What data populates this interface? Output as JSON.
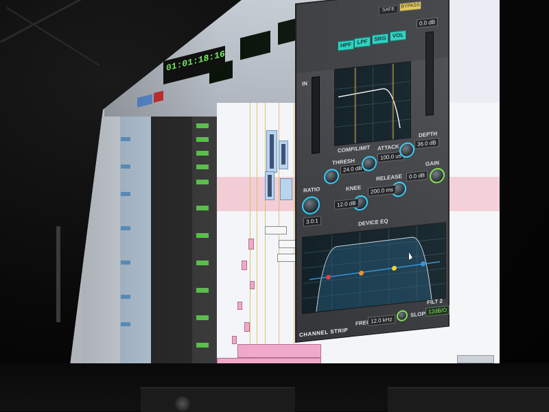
{
  "transport": {
    "counter": "01:01:18:16"
  },
  "plugin": {
    "title": "CHANNEL STRIP",
    "header": {
      "bypass": "BYPASS",
      "safe": "SAFE",
      "filter_buttons": [
        "HPF",
        "LPF",
        "SRG",
        "VOL"
      ]
    },
    "meters": {
      "in_label": "IN",
      "vol_value": "0.0 dB"
    },
    "comp": {
      "section": "COMP/LIMIT",
      "thresh_label": "THRESH",
      "thresh_value": "24.0 dB",
      "attack_label": "ATTACK",
      "attack_value": "100.0 us",
      "depth_label": "DEPTH",
      "depth_value": "36.0 dB",
      "ratio_label": "RATIO",
      "ratio_value": "3.0:1",
      "knee_label": "KNEE",
      "knee_value": "12.0 dB",
      "release_label": "RELEASE",
      "release_value": "200.0 ms",
      "gain_label": "GAIN",
      "gain_value": "0.0 dB"
    },
    "eq": {
      "section": "DEVICE EQ",
      "freq_label": "FREQ",
      "freq_value": "12.0 kHz",
      "slope_label": "SLOPE",
      "slope_value": "12dB/O",
      "filter_label": "FILT 2"
    }
  },
  "colors": {
    "accent_teal": "#27d0c0",
    "knob_ring_blue": "#2ad0ff",
    "knob_ring_green": "#7fe04a",
    "eq_curve": "#2f8fd6",
    "clip_pink": "#f0a8c8"
  }
}
